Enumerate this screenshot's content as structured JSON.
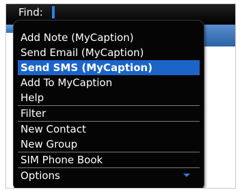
{
  "find": {
    "label": "Find:"
  },
  "menu": {
    "items": [
      {
        "label": "Add Note (MyCaption)",
        "selected": false,
        "separator_before": false
      },
      {
        "label": "Send Email (MyCaption)",
        "selected": false,
        "separator_before": false
      },
      {
        "label": "Send SMS (MyCaption)",
        "selected": true,
        "separator_before": false
      },
      {
        "label": "Add To MyCaption",
        "selected": false,
        "separator_before": false
      },
      {
        "label": "Help",
        "selected": false,
        "separator_before": false
      },
      {
        "label": "Filter",
        "selected": false,
        "separator_before": true
      },
      {
        "label": "New Contact",
        "selected": false,
        "separator_before": true
      },
      {
        "label": "New Group",
        "selected": false,
        "separator_before": false
      },
      {
        "label": "SIM Phone Book",
        "selected": false,
        "separator_before": true
      },
      {
        "label": "Options",
        "selected": false,
        "separator_before": true
      }
    ],
    "scroll_icon": "chevron-down-icon"
  },
  "colors": {
    "menu_background": "#050505",
    "selection": "#1d64c8",
    "text": "#ffffff",
    "separator": "#7c7c7c",
    "accent": "#2f7fe8"
  }
}
